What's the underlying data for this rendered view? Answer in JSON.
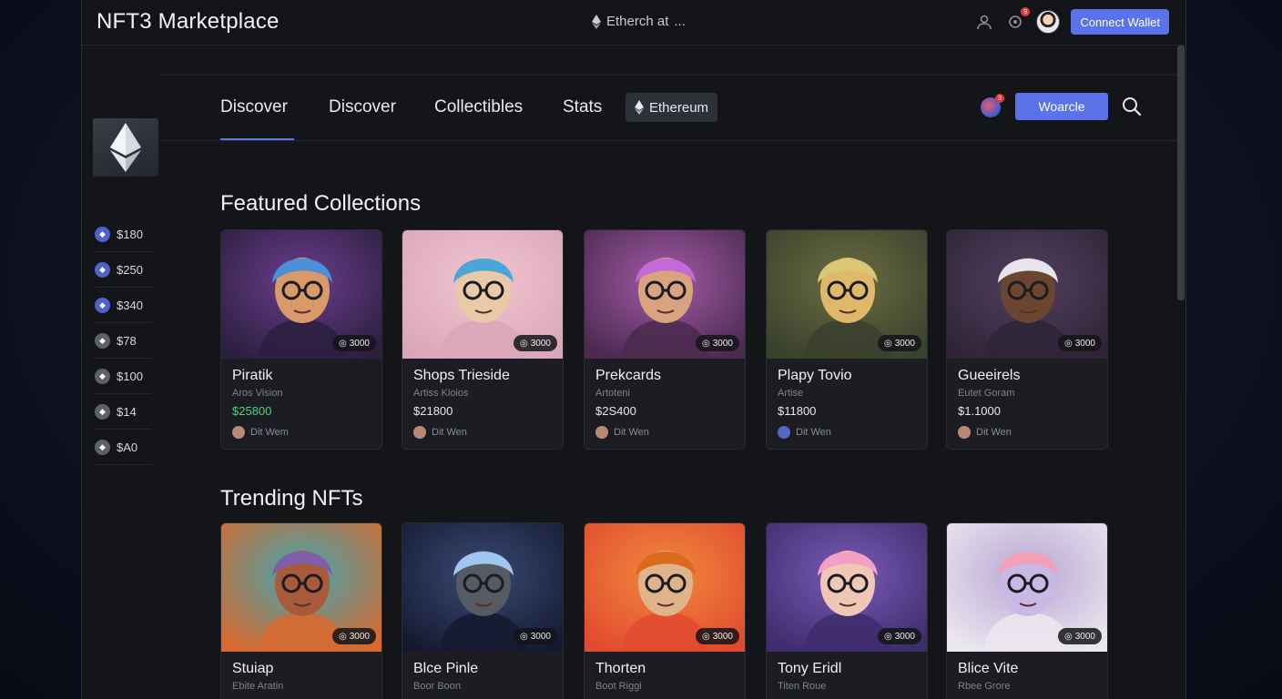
{
  "app": {
    "title": "NFT3 Marketplace"
  },
  "topbar": {
    "network_label": "Etherch at",
    "network_more": "...",
    "notification_count": "9",
    "connect_label": "Connect Wallet"
  },
  "sidebar": {
    "items": [
      {
        "label": "$180",
        "icon": "eth-coin-icon",
        "accent": true
      },
      {
        "label": "$250",
        "icon": "eth-coin-icon",
        "accent": true
      },
      {
        "label": "$340",
        "icon": "eth-coin-icon",
        "accent": true
      },
      {
        "label": "$78",
        "icon": "coin-icon",
        "accent": false
      },
      {
        "label": "$100",
        "icon": "coin-icon",
        "accent": false
      },
      {
        "label": "$14",
        "icon": "coin-icon",
        "accent": false
      },
      {
        "label": "$A0",
        "icon": "coin-icon",
        "accent": false
      }
    ]
  },
  "nav": {
    "tabs": [
      "Discover",
      "Discover",
      "Collectibles",
      "Stats"
    ],
    "network_pill": "Ethereum",
    "orb_badge": "3",
    "primary_button": "Woarcle"
  },
  "featured": {
    "title": "Featured Collections",
    "cards": [
      {
        "name": "Piratik",
        "artist": "Aros Vision",
        "price": "$25800",
        "owner": "Dit Wem",
        "tag": "3000",
        "price_green": true
      },
      {
        "name": "Shops Trieside",
        "artist": "Artiss Kloios",
        "price": "$21800",
        "owner": "Dit Wen",
        "tag": "3000",
        "price_green": false
      },
      {
        "name": "Prekcards",
        "artist": "Artoteni",
        "price": "$2S400",
        "owner": "Dit Wen",
        "tag": "3000",
        "price_green": false
      },
      {
        "name": "Plapy Tovio",
        "artist": "Artise",
        "price": "$11800",
        "owner": "Dit Wen",
        "tag": "3000",
        "price_green": false
      },
      {
        "name": "Gueeirels",
        "artist": "Eutet Goram",
        "price": "$1.1000",
        "owner": "Dit Wen",
        "tag": "3000",
        "price_green": false
      }
    ]
  },
  "trending": {
    "title": "Trending NFTs",
    "cards": [
      {
        "name": "Stuiap",
        "artist": "Ebite Aratin",
        "tag": "3000"
      },
      {
        "name": "Blce Pinle",
        "artist": "Boor Boon",
        "tag": "3000"
      },
      {
        "name": "Thorten",
        "artist": "Boot Riggi",
        "tag": "3000"
      },
      {
        "name": "Tony Eridl",
        "artist": "Titen Roue",
        "tag": "3000"
      },
      {
        "name": "Blice Vite",
        "artist": "Rbee Grore",
        "tag": "3000"
      }
    ]
  },
  "colors": {
    "accent": "#5b73e8",
    "background": "#141519",
    "card": "#1c1d22",
    "price_green": "#4cd07a"
  }
}
